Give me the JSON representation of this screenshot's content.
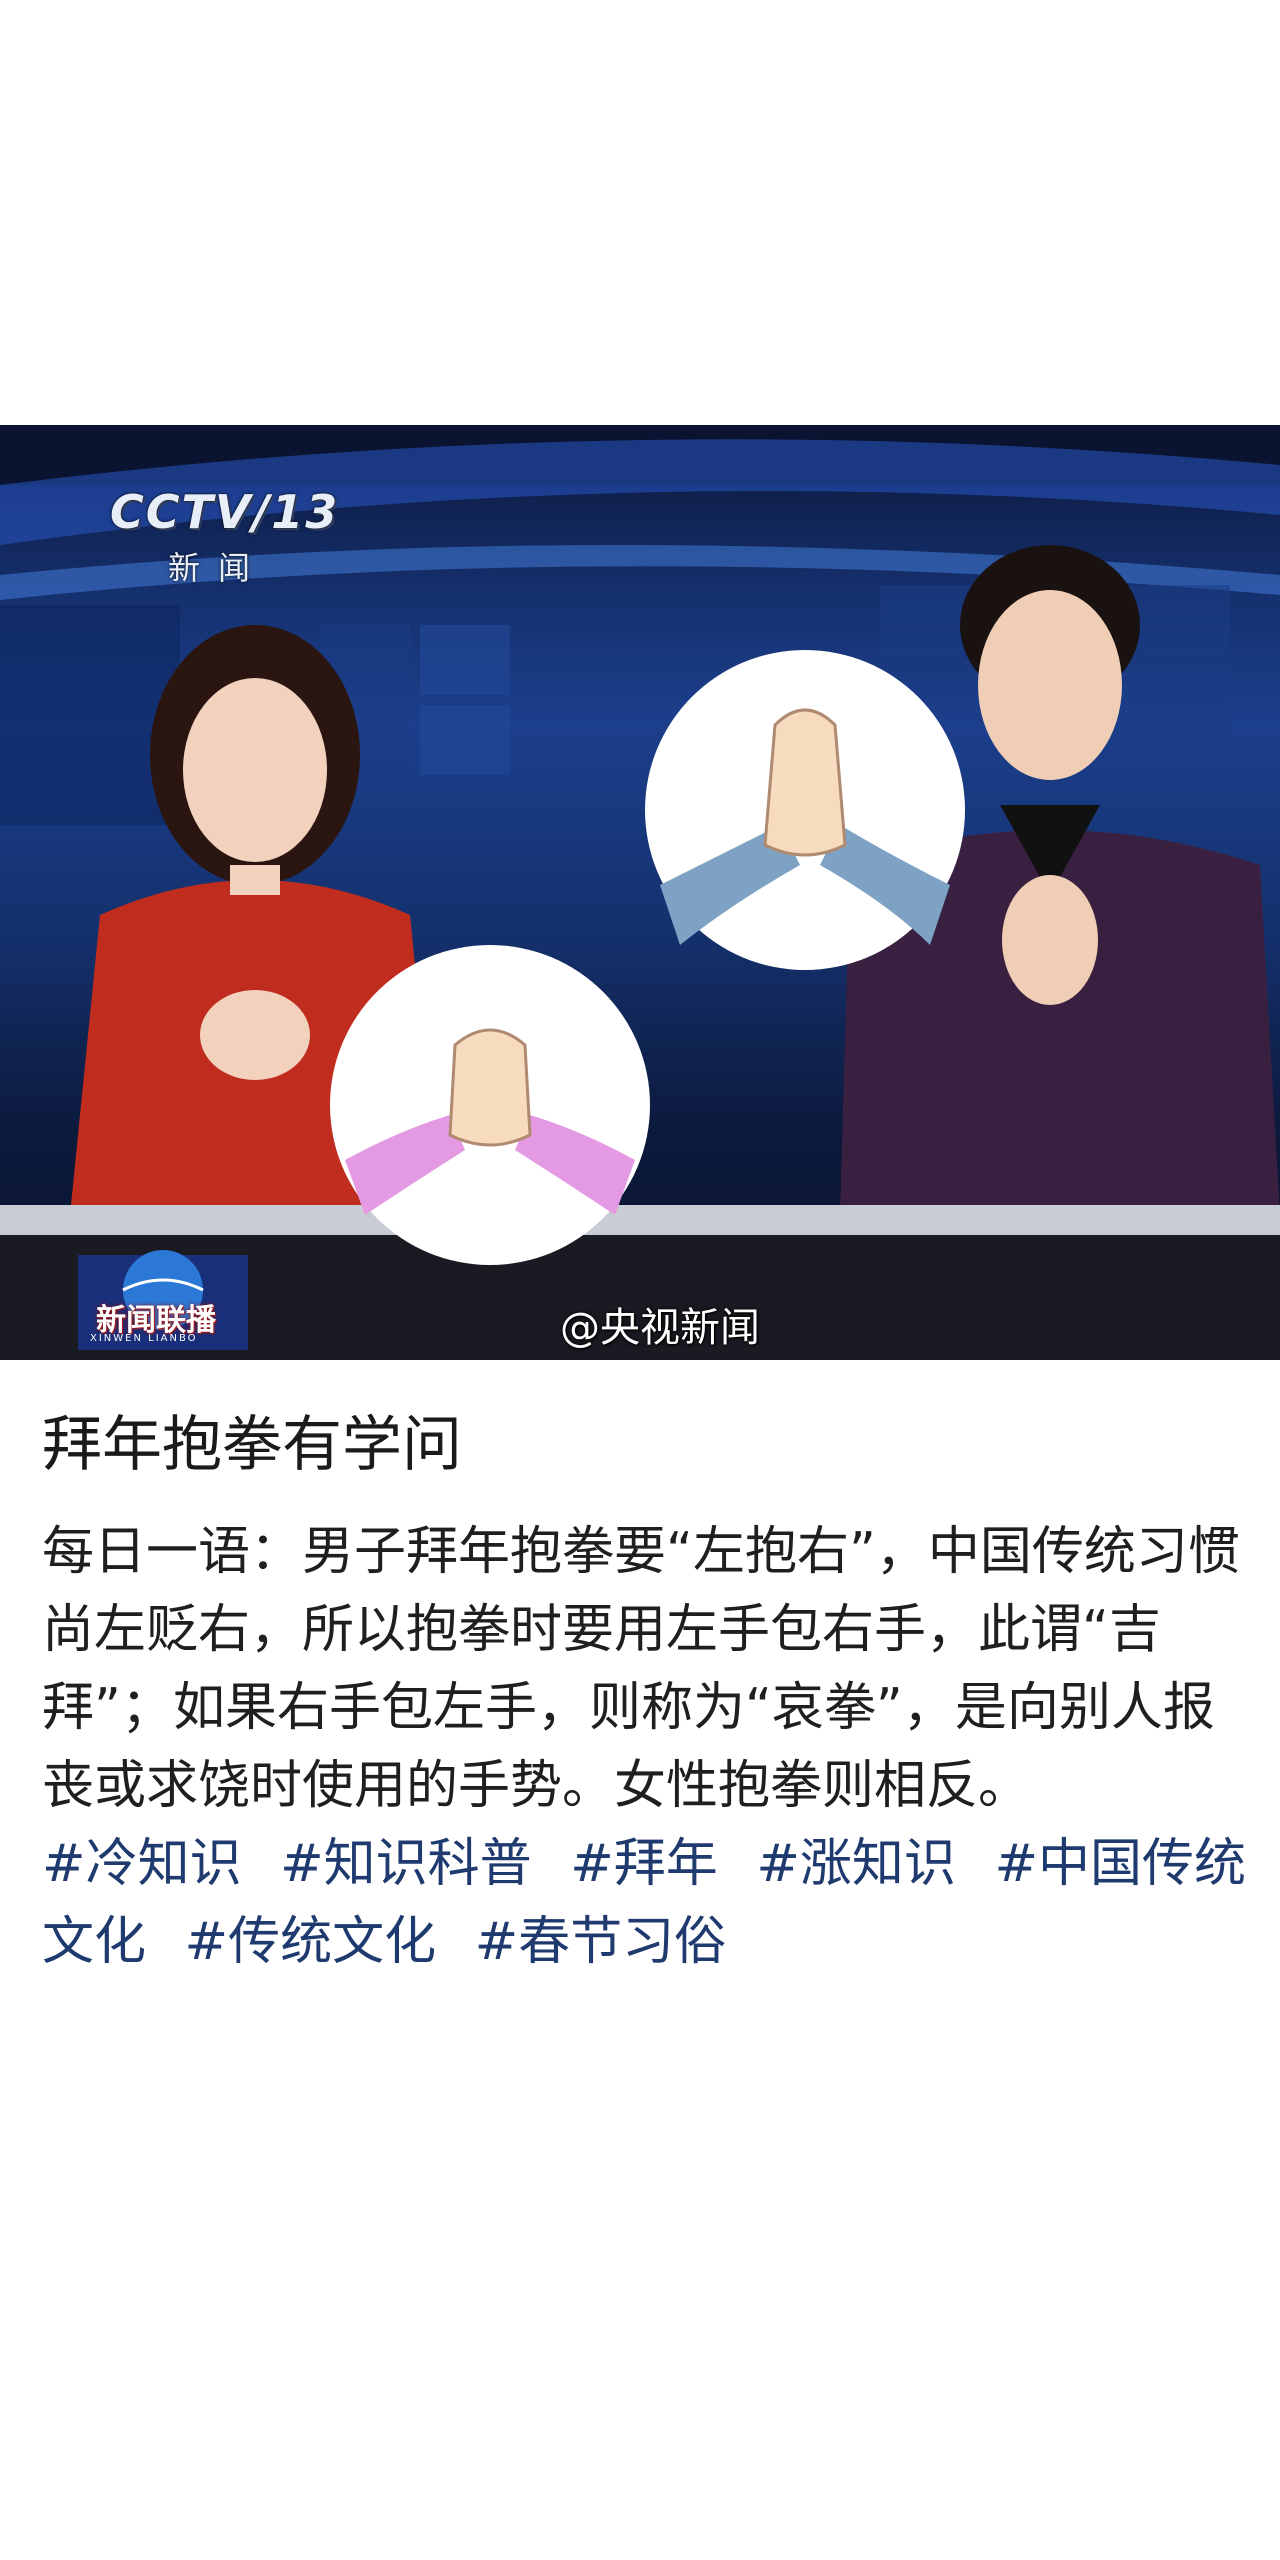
{
  "photo": {
    "channel_logo": "CCTV/13",
    "channel_sub": "新闻",
    "program_name": "新闻联播",
    "program_sub": "XINWEN LIANBO",
    "watermark": "@央视新闻"
  },
  "post": {
    "title": "拜年抱拳有学问",
    "body": "每日一语：男子拜年抱拳要“左抱右”，中国传统习惯尚左贬右，所以抱拳时要用左手包右手，此谓“吉拜”；如果右手包左手，则称为“哀拳”，是向别人报丧或求饶时使用的手势。女性抱拳则相反。",
    "tags": [
      "#冷知识",
      "#知识科普",
      "#拜年",
      "#涨知识",
      "#中国传统文化",
      "#传统文化",
      "#春节习俗"
    ]
  }
}
